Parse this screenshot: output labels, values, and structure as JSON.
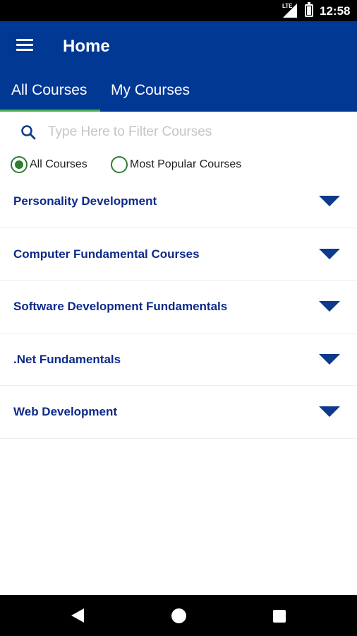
{
  "status_bar": {
    "network": "LTE",
    "time": "12:58"
  },
  "app_bar": {
    "title": "Home",
    "color": "#003893"
  },
  "tabs": [
    {
      "label": "All Courses",
      "selected": true
    },
    {
      "label": "My Courses",
      "selected": false
    }
  ],
  "search": {
    "value": "",
    "placeholder": "Type Here to Filter Courses"
  },
  "filters": [
    {
      "label": "All Courses",
      "selected": true
    },
    {
      "label": "Most Popular Courses",
      "selected": false
    }
  ],
  "courses": [
    {
      "title": "Personality Development"
    },
    {
      "title": "Computer Fundamental Courses"
    },
    {
      "title": "Software Development Fundamentals"
    },
    {
      "title": ".Net Fundamentals"
    },
    {
      "title": "Web Development"
    }
  ],
  "icons": {
    "menu": "menu-icon",
    "search": "search-icon",
    "expand": "chevron-down-icon",
    "nav_back": "back-icon",
    "nav_home": "home-icon",
    "nav_recent": "recent-apps-icon"
  },
  "colors": {
    "primary": "#003893",
    "accent": "#4caf50",
    "radio": "#2e7d32",
    "course_text": "#0d2a8a"
  }
}
